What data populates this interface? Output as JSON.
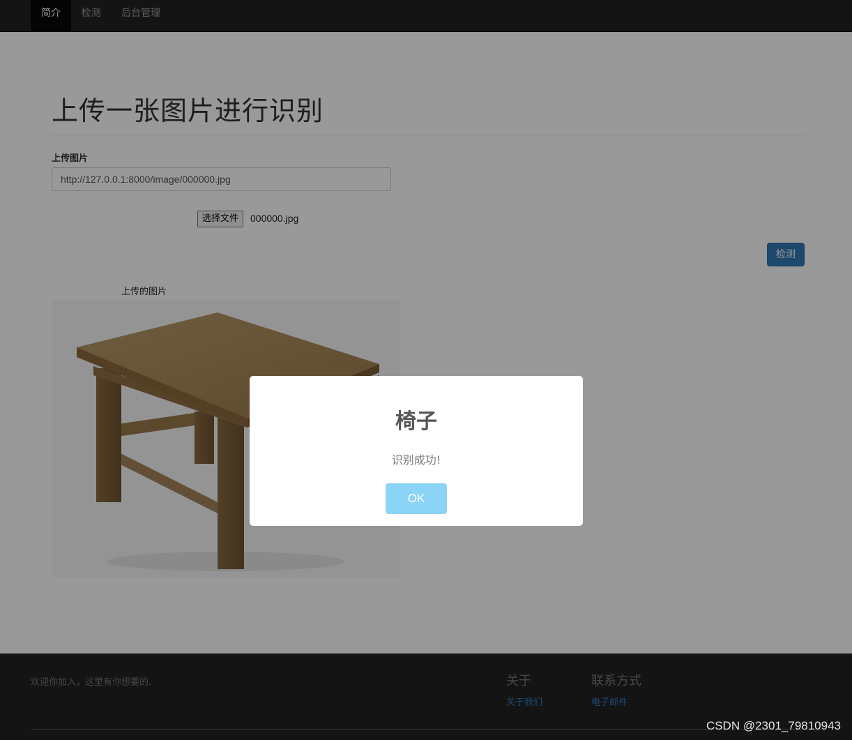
{
  "nav": {
    "items": [
      {
        "label": "简介",
        "active": true
      },
      {
        "label": "检测",
        "active": false
      },
      {
        "label": "后台管理",
        "active": false
      }
    ]
  },
  "main": {
    "title": "上传一张图片进行识别",
    "upload_label": "上传图片",
    "url_value": "http://127.0.0.1:8000/image/000000.jpg",
    "choose_file_label": "选择文件",
    "file_name": "000000.jpg",
    "detect_button": "检测",
    "preview_caption": "上传的图片"
  },
  "footer": {
    "welcome": "欢迎你加入，这里有你想要的.",
    "about_heading": "关于",
    "about_link": "关于我们",
    "contact_heading": "联系方式",
    "contact_link": "电子邮件"
  },
  "modal": {
    "title": "椅子",
    "message": "识别成功!",
    "ok_label": "OK"
  },
  "watermark": "CSDN @2301_79810943",
  "colors": {
    "navbar": "#222222",
    "primary": "#337ab7",
    "ok_button": "#8CD4F5",
    "overlay": "rgba(0,0,0,0.4)"
  }
}
